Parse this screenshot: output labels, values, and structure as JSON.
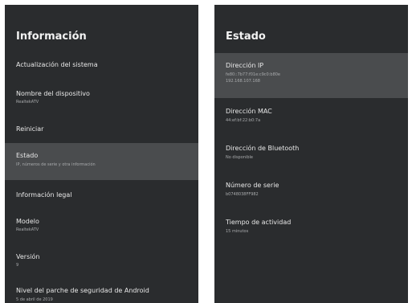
{
  "left_panel": {
    "title": "Información",
    "items": [
      {
        "label": "Actualización del sistema"
      },
      {
        "label": "Nombre del dispositivo",
        "value": "RealtekATV"
      },
      {
        "label": "Reiniciar"
      },
      {
        "label": "Estado",
        "value": "IP, números de serie y otra información"
      },
      {
        "label": "Información legal"
      },
      {
        "label": "Modelo",
        "value": "RealtekATV"
      },
      {
        "label": "Versión",
        "value": "9"
      },
      {
        "label": "Nivel del parche de seguridad de Android",
        "value": "5 de abril de 2019"
      }
    ]
  },
  "right_panel": {
    "title": "Estado",
    "items": [
      {
        "label": "Dirección IP",
        "value": "fe80::7b77:f01e:c9c0:b80e",
        "value2": "192.168.107.168"
      },
      {
        "label": "Dirección MAC",
        "value": "44:ef:bf:22:b0:7a"
      },
      {
        "label": "Dirección de Bluetooth",
        "value": "No disponible"
      },
      {
        "label": "Número de serie",
        "value": "b0748038FF982"
      },
      {
        "label": "Tiempo de actividad",
        "value": "15 minutos"
      }
    ]
  },
  "colors": {
    "panel_bg": "#2a2c2e",
    "highlight_bg": "#4a4c4e",
    "title_text": "#f2f2f2",
    "primary_text": "#e8e8e8",
    "secondary_text": "#a9abad"
  }
}
